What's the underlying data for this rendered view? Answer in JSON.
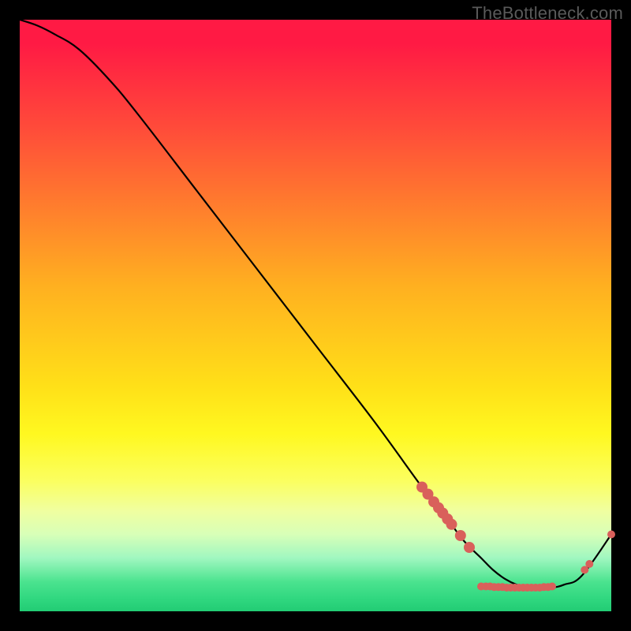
{
  "watermark": "TheBottleneck.com",
  "chart_data": {
    "type": "line",
    "title": "",
    "xlabel": "",
    "ylabel": "",
    "xlim": [
      0,
      100
    ],
    "ylim": [
      0,
      100
    ],
    "grid": false,
    "legend": false,
    "series": [
      {
        "name": "curve",
        "color": "#000000",
        "x": [
          0,
          3,
          6,
          10,
          15,
          20,
          30,
          40,
          50,
          60,
          68,
          72,
          75,
          78,
          80,
          82,
          84,
          86,
          88,
          90,
          92,
          95,
          100
        ],
        "y": [
          100,
          99,
          97.5,
          95,
          90,
          84,
          71,
          58,
          45,
          32,
          21,
          16,
          12,
          9,
          7,
          5.5,
          4.5,
          4,
          4,
          4,
          4.5,
          6,
          13
        ]
      }
    ],
    "markers": [
      {
        "seg": "desc",
        "x": 68.0,
        "y": 21.0
      },
      {
        "seg": "desc",
        "x": 69.0,
        "y": 19.8
      },
      {
        "seg": "desc",
        "x": 70.0,
        "y": 18.5
      },
      {
        "seg": "desc",
        "x": 70.8,
        "y": 17.5
      },
      {
        "seg": "desc",
        "x": 71.5,
        "y": 16.6
      },
      {
        "seg": "desc",
        "x": 72.3,
        "y": 15.6
      },
      {
        "seg": "desc",
        "x": 73.0,
        "y": 14.7
      },
      {
        "seg": "desc",
        "x": 74.5,
        "y": 12.8
      },
      {
        "seg": "desc",
        "x": 76.0,
        "y": 10.8
      },
      {
        "seg": "flat",
        "x": 78.0,
        "y": 4.2
      },
      {
        "seg": "flat",
        "x": 78.8,
        "y": 4.2
      },
      {
        "seg": "flat",
        "x": 79.5,
        "y": 4.2
      },
      {
        "seg": "flat",
        "x": 80.2,
        "y": 4.1
      },
      {
        "seg": "flat",
        "x": 80.9,
        "y": 4.1
      },
      {
        "seg": "flat",
        "x": 81.6,
        "y": 4.1
      },
      {
        "seg": "flat",
        "x": 82.3,
        "y": 4.0
      },
      {
        "seg": "flat",
        "x": 83.0,
        "y": 4.0
      },
      {
        "seg": "flat",
        "x": 83.7,
        "y": 4.0
      },
      {
        "seg": "flat",
        "x": 84.4,
        "y": 4.0
      },
      {
        "seg": "flat",
        "x": 85.1,
        "y": 4.0
      },
      {
        "seg": "flat",
        "x": 85.8,
        "y": 4.0
      },
      {
        "seg": "flat",
        "x": 86.5,
        "y": 4.0
      },
      {
        "seg": "flat",
        "x": 87.2,
        "y": 4.0
      },
      {
        "seg": "flat",
        "x": 87.9,
        "y": 4.0
      },
      {
        "seg": "flat",
        "x": 88.6,
        "y": 4.1
      },
      {
        "seg": "flat",
        "x": 89.3,
        "y": 4.1
      },
      {
        "seg": "flat",
        "x": 90.0,
        "y": 4.2
      },
      {
        "seg": "rise",
        "x": 95.5,
        "y": 7.0
      },
      {
        "seg": "rise",
        "x": 96.3,
        "y": 8.0
      },
      {
        "seg": "rise",
        "x": 100.0,
        "y": 13.0
      }
    ],
    "marker_style": {
      "color": "#d9605b",
      "r_small": 5,
      "r_big": 7
    }
  }
}
